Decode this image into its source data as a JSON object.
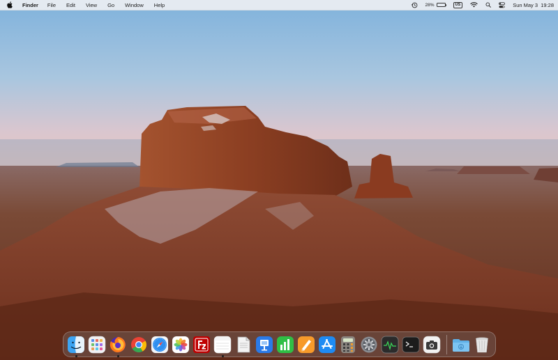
{
  "menubar": {
    "apple_icon": "apple-logo-icon",
    "app_name": "Finder",
    "menus": [
      "File",
      "Edit",
      "View",
      "Go",
      "Window",
      "Help"
    ],
    "status": {
      "time_machine_icon": "time-machine-icon",
      "battery_percent_label": "28%",
      "battery_level": 0.28,
      "input_source": "US",
      "wifi_icon": "wifi-icon",
      "spotlight_icon": "spotlight-search-icon",
      "control_center_icon": "control-center-icon",
      "date": "Sun May 3",
      "time": "19:28"
    }
  },
  "colors": {
    "menubar_bg": "#eceef2",
    "sky_top": "#7fb2dc",
    "sky_horizon": "#e9c2b8",
    "rock": "#8a3e22",
    "ground": "#6e3a26"
  },
  "dock": {
    "apps": [
      {
        "name": "Finder",
        "icon": "finder-icon",
        "running": true
      },
      {
        "name": "Launchpad",
        "icon": "launchpad-icon",
        "running": false
      },
      {
        "name": "Firefox",
        "icon": "firefox-icon",
        "running": true
      },
      {
        "name": "Google Chrome",
        "icon": "chrome-icon",
        "running": false
      },
      {
        "name": "Safari",
        "icon": "safari-icon",
        "running": false
      },
      {
        "name": "Photos",
        "icon": "photos-icon",
        "running": false
      },
      {
        "name": "FileZilla",
        "icon": "filezilla-icon",
        "running": false
      },
      {
        "name": "Notes",
        "icon": "notes-icon",
        "running": true
      },
      {
        "name": "TextEdit",
        "icon": "textedit-icon",
        "running": false
      },
      {
        "name": "Keynote",
        "icon": "keynote-icon",
        "running": false
      },
      {
        "name": "Numbers",
        "icon": "numbers-icon",
        "running": false
      },
      {
        "name": "Pages",
        "icon": "pages-icon",
        "running": false
      },
      {
        "name": "App Store",
        "icon": "app-store-icon",
        "running": false
      },
      {
        "name": "Calculator",
        "icon": "calculator-icon",
        "running": false
      },
      {
        "name": "System Preferences",
        "icon": "system-preferences-icon",
        "running": false
      },
      {
        "name": "Activity Monitor",
        "icon": "activity-monitor-icon",
        "running": false
      },
      {
        "name": "Terminal",
        "icon": "terminal-icon",
        "running": false
      },
      {
        "name": "Screenshot",
        "icon": "screenshot-icon",
        "running": false
      }
    ],
    "folder": {
      "name": "Downloads",
      "icon": "downloads-folder-icon"
    },
    "trash": {
      "name": "Trash",
      "icon": "trash-icon"
    }
  }
}
